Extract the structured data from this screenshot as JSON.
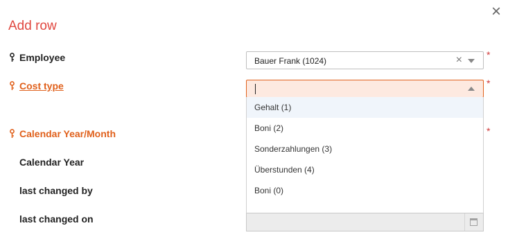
{
  "dialog": {
    "title": "Add row",
    "close_label": "×"
  },
  "fields": {
    "employee": {
      "label": "Employee",
      "value": "Bauer Frank (1024)",
      "required": "*"
    },
    "cost_type": {
      "label": "Cost type",
      "value": "",
      "required": "*"
    },
    "calendar_year_month": {
      "label": "Calendar Year/Month",
      "required": "*"
    },
    "calendar_year": {
      "label": "Calendar Year"
    },
    "last_changed_by": {
      "label": "last changed by"
    },
    "last_changed_on": {
      "label": "last changed on",
      "value": ""
    }
  },
  "dropdown": {
    "options": [
      {
        "label": "Gehalt (1)"
      },
      {
        "label": "Boni (2)"
      },
      {
        "label": "Sonderzahlungen (3)"
      },
      {
        "label": "Überstunden (4)"
      },
      {
        "label": "Boni (0)"
      }
    ],
    "highlighted_index": 0
  },
  "icons": {
    "key": "key-icon",
    "close": "close-icon",
    "clear": "clear-icon",
    "calendar": "calendar-icon"
  },
  "colors": {
    "title": "#e0473f",
    "orange_label": "#e0601b",
    "active_field_bg": "#fde9e0",
    "required": "#d03a3a"
  }
}
